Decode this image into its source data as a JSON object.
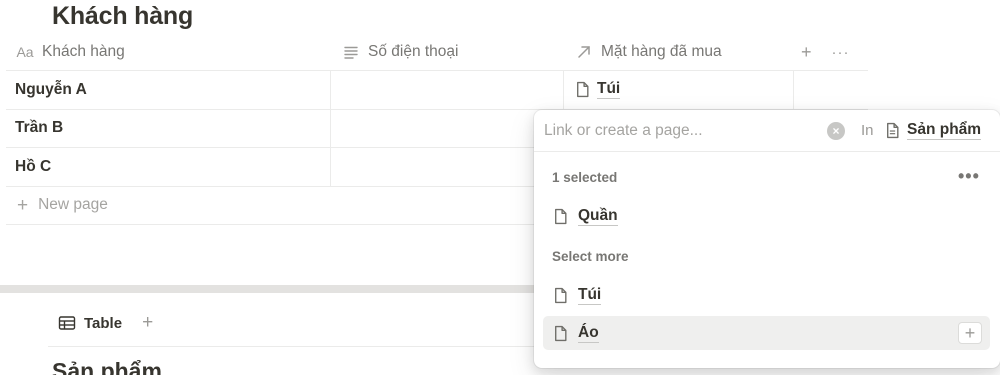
{
  "page": {
    "title": "Khách hàng",
    "second_db_title": "Sản phẩm"
  },
  "table": {
    "columns": [
      {
        "label": "Khách hàng",
        "icon": "text-aa-icon"
      },
      {
        "label": "Số điện thoại",
        "icon": "lines-icon"
      },
      {
        "label": "Mặt hàng đã mua",
        "icon": "relation-arrow-icon"
      }
    ],
    "add_column": "+",
    "more": "···",
    "rows": [
      {
        "name": "Nguyễn A",
        "phone": "",
        "items": "Túi"
      },
      {
        "name": "Trần B",
        "phone": "",
        "items": ""
      },
      {
        "name": "Hồ C",
        "phone": "",
        "items": ""
      }
    ],
    "new_page": "New page"
  },
  "views": {
    "tab_label": "Table",
    "add": "+"
  },
  "popup": {
    "search_placeholder": "Link or create a page...",
    "in_label": "In",
    "database": "Sản phẩm",
    "selected_label": "1 selected",
    "more": "•••",
    "selected": [
      "Quần"
    ],
    "select_more_label": "Select more",
    "options": [
      "Túi",
      "Áo"
    ],
    "add": "+"
  },
  "colors": {
    "text": "#37352f",
    "muted": "#787774",
    "border": "#ebebea",
    "hover": "#efefee",
    "band": "#e3e2e0"
  }
}
